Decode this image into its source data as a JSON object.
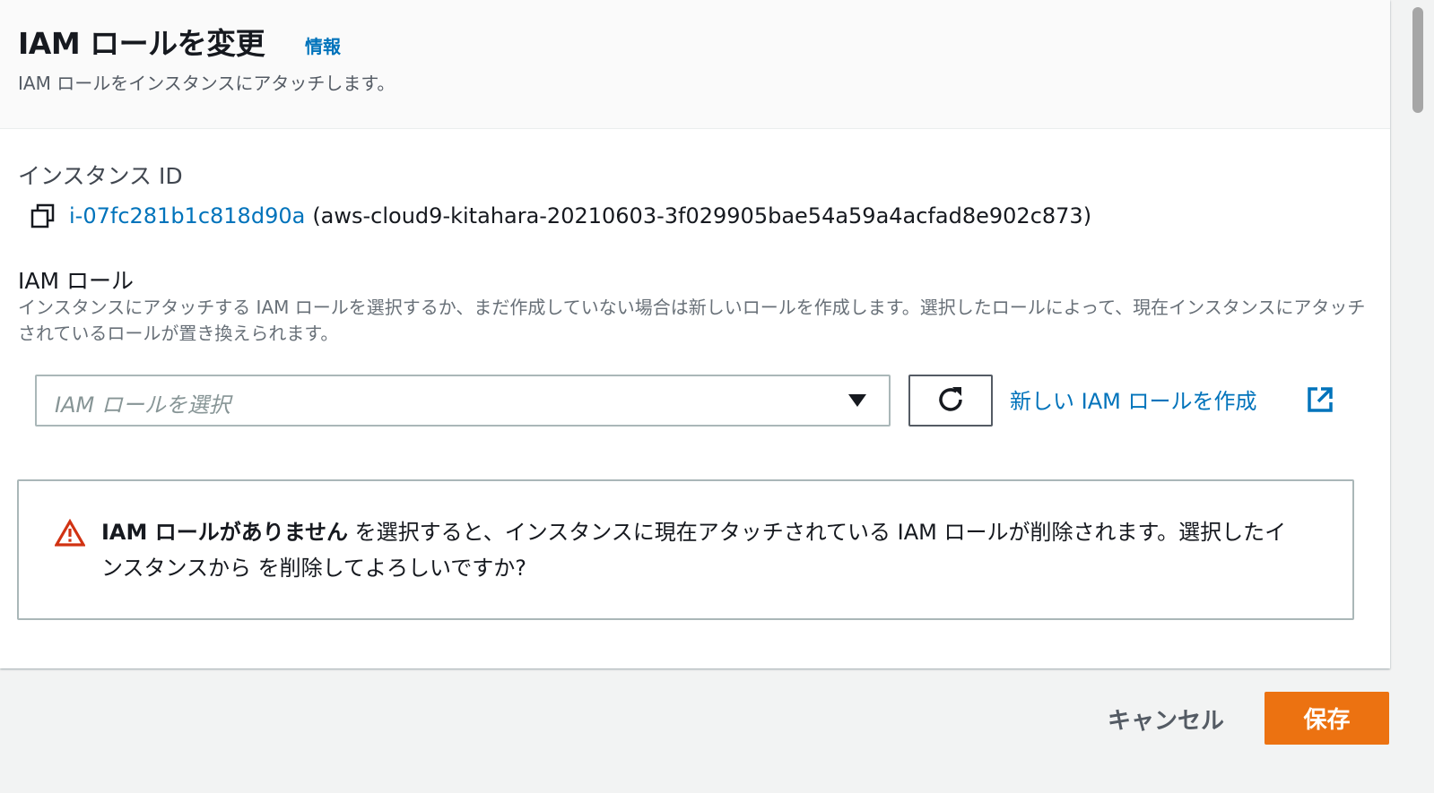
{
  "header": {
    "title": "IAM ロールを変更",
    "info_link": "情報",
    "subtitle": "IAM ロールをインスタンスにアタッチします。"
  },
  "instance": {
    "label": "インスタンス ID",
    "id": "i-07fc281b1c818d90a",
    "name": "(aws-cloud9-kitahara-20210603-3f029905bae54a59a4acfad8e902c873)"
  },
  "iam_role": {
    "label": "IAM ロール",
    "description": "インスタンスにアタッチする IAM ロールを選択するか、まだ作成していない場合は新しいロールを作成します。選択したロールによって、現在インスタンスにアタッチされているロールが置き換えられます。",
    "select_placeholder": "IAM ロールを選択",
    "create_link": "新しい IAM ロールを作成"
  },
  "alert": {
    "strong": "IAM ロールがありません",
    "text": " を選択すると、インスタンスに現在アタッチされている IAM ロールが削除されます。選択したインスタンスから を削除してよろしいですか?"
  },
  "footer": {
    "cancel_label": "キャンセル",
    "save_label": "保存"
  },
  "icons": {
    "copy": "copy-icon",
    "caret": "caret-down-icon",
    "refresh": "refresh-icon",
    "external": "external-link-icon",
    "warning": "warning-icon"
  },
  "colors": {
    "link": "#0073bb",
    "primary": "#ec7211",
    "warning": "#d13212",
    "text": "#16191f",
    "muted": "#687078"
  }
}
